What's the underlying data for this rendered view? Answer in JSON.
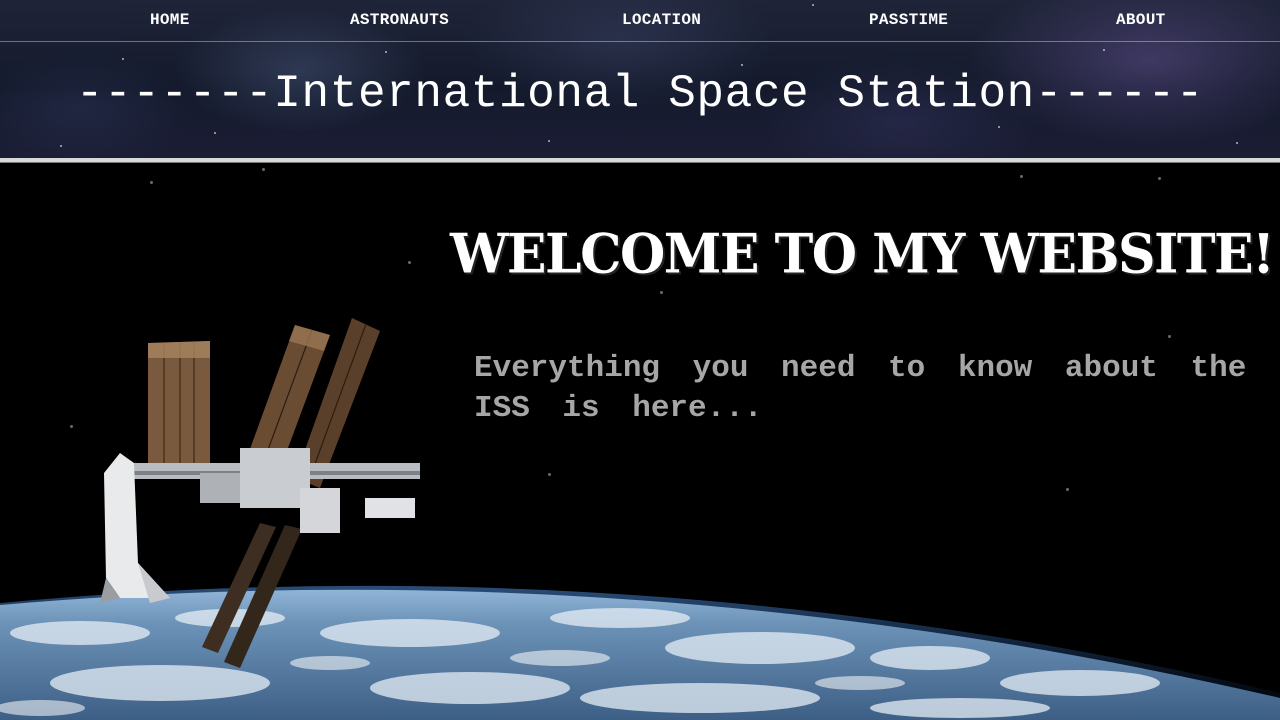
{
  "nav": {
    "items": [
      {
        "label": "HOME"
      },
      {
        "label": "ASTRONAUTS"
      },
      {
        "label": "LOCATION"
      },
      {
        "label": "PASSTIME"
      },
      {
        "label": "ABOUT"
      }
    ]
  },
  "header": {
    "title": "-------International Space Station------"
  },
  "hero": {
    "heading": "WELCOME TO MY WEBSITE!",
    "tagline": "Everything you need to know about the ISS is here..."
  },
  "colors": {
    "nav_text": "#ffffff",
    "title_text": "#ffffff",
    "tagline_text": "#a6a6a6",
    "hero_background": "#000000",
    "divider": "#d8d8d8"
  },
  "icons": {
    "hero_image": "iss-over-earth-image"
  }
}
